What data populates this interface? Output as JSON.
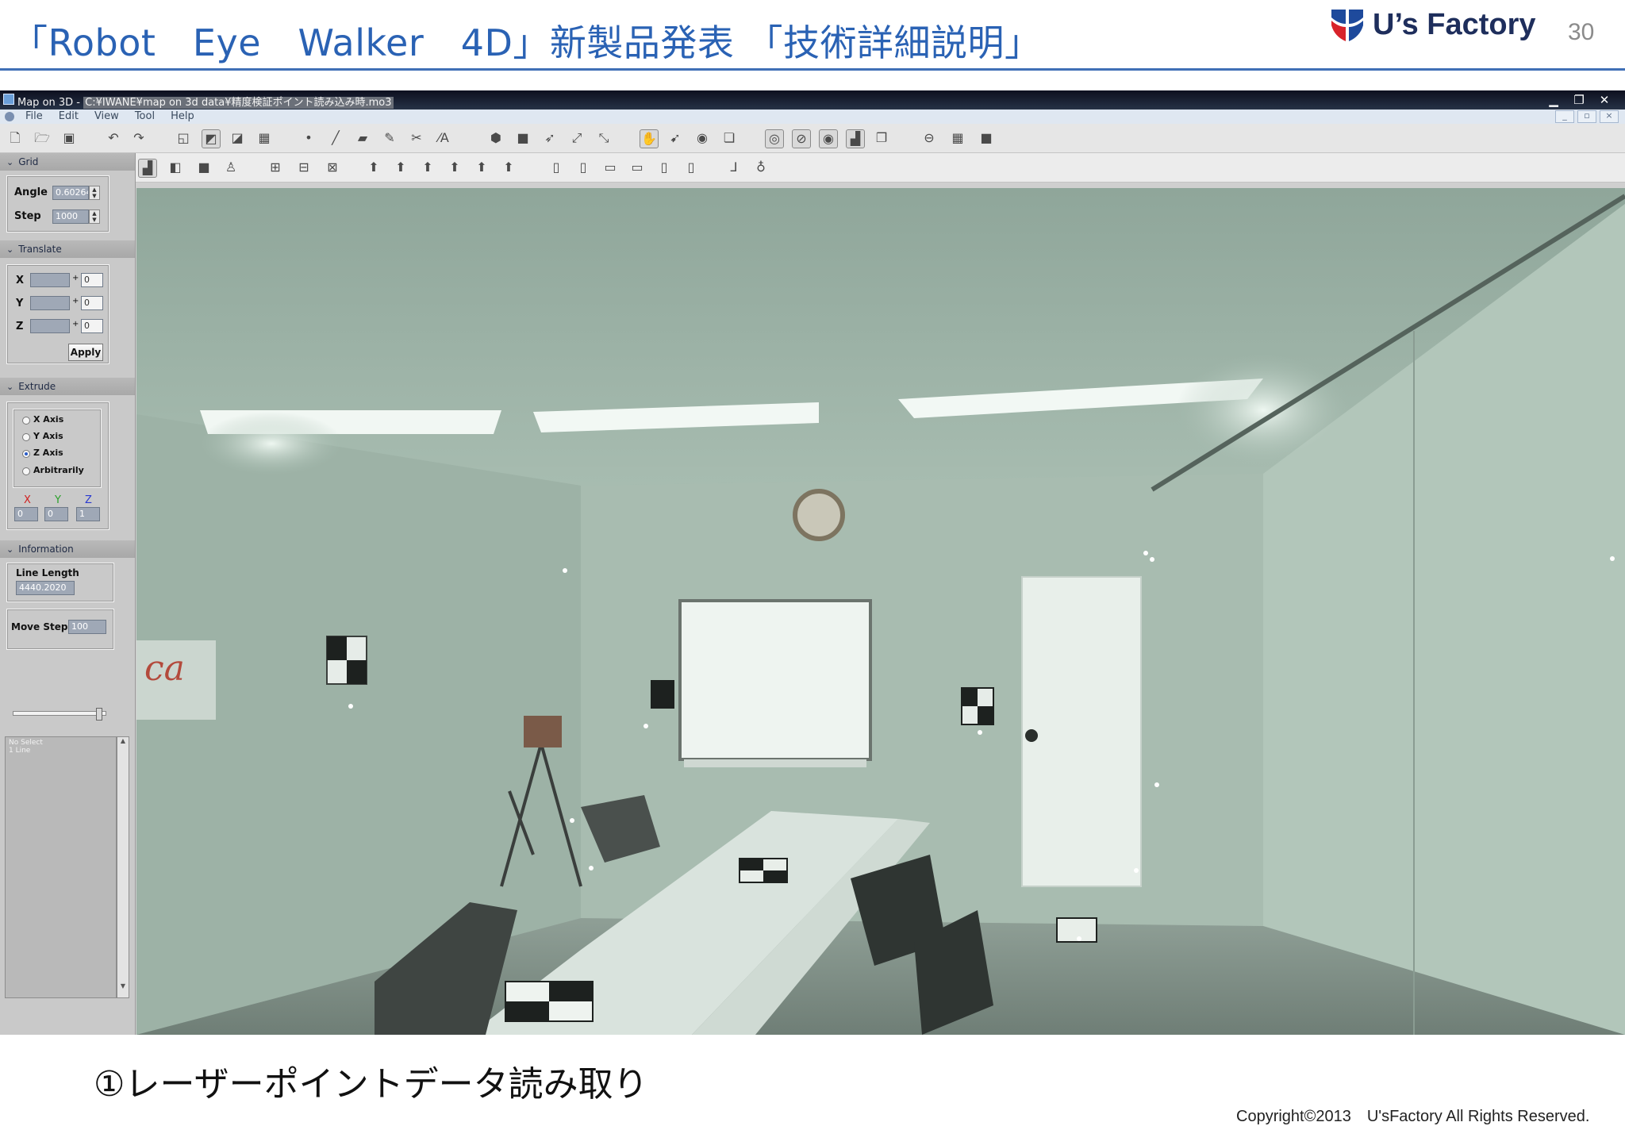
{
  "slide": {
    "title": "「Robot　Eye　Walker　4D」新製品発表 「技術詳細説明」",
    "logo_text": "U’s Factory",
    "page_number": "30",
    "caption": "①レーザーポイントデータ読み取り",
    "copyright": "Copyright©2013　U'sFactory All Rights Reserved.",
    "accent_color": "#2a62b4",
    "logo_colors": [
      "#1e4a9c",
      "#d8232a"
    ]
  },
  "window": {
    "title": "Map on 3D - ",
    "path": "C:¥IWANE¥map on 3d data¥精度検証ポイント読み込み時.mo3",
    "controls": [
      "minimize-icon",
      "restore-icon",
      "close-icon"
    ]
  },
  "menu": {
    "items": [
      "File",
      "Edit",
      "View",
      "Tool",
      "Help"
    ],
    "mdi_controls": [
      "_",
      "▫",
      "×"
    ]
  },
  "panel": {
    "grid": {
      "header": "Grid",
      "angle_label": "Angle",
      "angle_value": "0.60264",
      "step_label": "Step",
      "step_value": "1000"
    },
    "translate": {
      "header": "Translate",
      "x_label": "X",
      "y_label": "Y",
      "z_label": "Z",
      "x_value": "0",
      "y_value": "0",
      "z_value": "0",
      "plus": "+",
      "apply_label": "Apply"
    },
    "extrude": {
      "header": "Extrude",
      "options": [
        "X Axis",
        "Y Axis",
        "Z Axis",
        "Arbitrarily"
      ],
      "selected": "Z Axis",
      "axis_x": "X",
      "axis_y": "Y",
      "axis_z": "Z",
      "vx": "0",
      "vy": "0",
      "vz": "1"
    },
    "information": {
      "header": "Information",
      "line_length_label": "Line Length",
      "line_length_value": "4440.2020",
      "move_step_label": "Move Step",
      "move_step_value": "100",
      "list_items": [
        "No Select",
        "1 Line"
      ]
    }
  },
  "viewport": {
    "scene": "point-cloud-meeting-room",
    "tint_color": "#a8bdb1"
  }
}
